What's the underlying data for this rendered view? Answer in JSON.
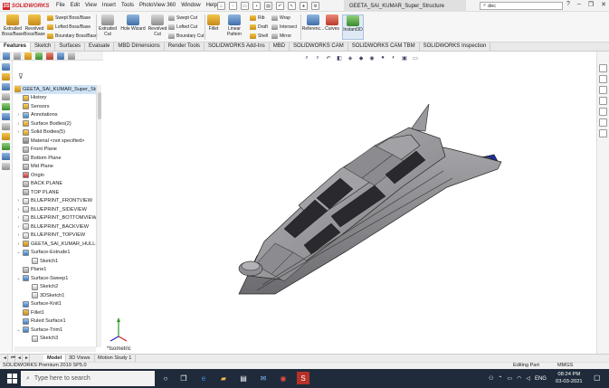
{
  "app": {
    "logo_text": "SOLIDWORKS",
    "document_title": "GEETA_SAI_KUMAR_Super_Structure",
    "search_value": "dec"
  },
  "menu": [
    "File",
    "Edit",
    "View",
    "Insert",
    "Tools",
    "PhotoView 360",
    "Window",
    "Help"
  ],
  "ribbon": {
    "extruded_boss": "Extruded Boss/Base",
    "revolved_boss": "Revolved Boss/Base",
    "swept_boss": "Swept Boss/Base",
    "lofted_boss": "Lofted Boss/Base",
    "boundary_boss": "Boundary Boss/Base",
    "extruded_cut": "Extruded Cut",
    "hole_wizard": "Hole Wizard",
    "revolved_cut": "Revolved Cut",
    "swept_cut": "Swept Cut",
    "lofted_cut": "Lofted Cut",
    "boundary_cut": "Boundary Cut",
    "fillet": "Fillet",
    "linear_pattern": "Linear Pattern",
    "rib": "Rib",
    "draft": "Draft",
    "shell": "Shell",
    "wrap": "Wrap",
    "intersect": "Intersect",
    "mirror": "Mirror",
    "reference": "Referenc...",
    "curves": "Curves",
    "instant3d": "Instant3D"
  },
  "command_tabs": [
    "Features",
    "Sketch",
    "Surfaces",
    "Evaluate",
    "MBD Dimensions",
    "Render Tools",
    "SOLIDWORKS Add-Ins",
    "MBD",
    "SOLIDWORKS CAM",
    "SOLIDWORKS CAM TBM",
    "SOLIDWORKS Inspection"
  ],
  "tree": {
    "root": "GEETA_SAI_KUMAR_Super_Structu",
    "items": [
      {
        "label": "History",
        "indent": 1,
        "exp": "",
        "icon": "folder"
      },
      {
        "label": "Sensors",
        "indent": 1,
        "exp": "",
        "icon": "folder"
      },
      {
        "label": "Annotations",
        "indent": 1,
        "exp": "›",
        "icon": "annot"
      },
      {
        "label": "Surface Bodies(2)",
        "indent": 1,
        "exp": "›",
        "icon": "folder"
      },
      {
        "label": "Solid Bodies(5)",
        "indent": 1,
        "exp": "›",
        "icon": "folder"
      },
      {
        "label": "Material <not specified>",
        "indent": 1,
        "exp": "",
        "icon": "material"
      },
      {
        "label": "Front Plane",
        "indent": 1,
        "exp": "",
        "icon": "plane"
      },
      {
        "label": "Bottom Plane",
        "indent": 1,
        "exp": "",
        "icon": "plane"
      },
      {
        "label": "Mid Plane",
        "indent": 1,
        "exp": "",
        "icon": "plane"
      },
      {
        "label": "Origin",
        "indent": 1,
        "exp": "",
        "icon": "origin"
      },
      {
        "label": "BACK PLANE",
        "indent": 1,
        "exp": "",
        "icon": "plane"
      },
      {
        "label": "TOP PLANE",
        "indent": 1,
        "exp": "",
        "icon": "plane"
      },
      {
        "label": "BLUEPRINT_FRONTVIEW",
        "indent": 1,
        "exp": "›",
        "icon": "sketch"
      },
      {
        "label": "BLUEPRINT_SIDEVIEW",
        "indent": 1,
        "exp": "›",
        "icon": "sketch"
      },
      {
        "label": "BLUEPRINT_BOTTOMVIEW",
        "indent": 1,
        "exp": "›",
        "icon": "sketch"
      },
      {
        "label": "BLUEPRINT_BACKVIEW",
        "indent": 1,
        "exp": "›",
        "icon": "sketch"
      },
      {
        "label": "BLUEPRINT_TOPVIEW",
        "indent": 1,
        "exp": "›",
        "icon": "sketch"
      },
      {
        "label": "GEETA_SAI_KUMAR_HULL->?",
        "indent": 1,
        "exp": "›",
        "icon": "part"
      },
      {
        "label": "Surface-Extrude1",
        "indent": 1,
        "exp": "⌄",
        "icon": "surface"
      },
      {
        "label": "Sketch1",
        "indent": 2,
        "exp": "",
        "icon": "sketch"
      },
      {
        "label": "Plane1",
        "indent": 1,
        "exp": "",
        "icon": "plane"
      },
      {
        "label": "Surface-Sweep1",
        "indent": 1,
        "exp": "⌄",
        "icon": "surface"
      },
      {
        "label": "Sketch2",
        "indent": 2,
        "exp": "",
        "icon": "sketch"
      },
      {
        "label": "3DSketch1",
        "indent": 2,
        "exp": "",
        "icon": "sketch"
      },
      {
        "label": "Surface-Knit1",
        "indent": 1,
        "exp": "",
        "icon": "surface"
      },
      {
        "label": "Fillet1",
        "indent": 1,
        "exp": "",
        "icon": "fillet"
      },
      {
        "label": "Ruled Surface1",
        "indent": 1,
        "exp": "",
        "icon": "surface"
      },
      {
        "label": "Surface-Trim1",
        "indent": 1,
        "exp": "⌄",
        "icon": "surface"
      },
      {
        "label": "Sketch3",
        "indent": 2,
        "exp": "",
        "icon": "sketch"
      }
    ]
  },
  "viewport": {
    "view_label": "*Isometric"
  },
  "bottom_tabs": [
    "Model",
    "3D Views",
    "Motion Study 1"
  ],
  "status": {
    "left": "SOLIDWORKS Premium 2019 SP5.0",
    "mode": "Editing Part",
    "units": "MMGS"
  },
  "taskbar": {
    "search_placeholder": "Type here to search",
    "language": "ENG",
    "time": "08:24 PM",
    "date": "03-03-2021"
  },
  "colors": {
    "accent": "#d2232a",
    "selection": "#cfe3f7",
    "model_body": "#8a8a8e",
    "model_glass": "#2a2a2e",
    "model_blue": "#1f2f9a",
    "taskbar": "#1f2b3a"
  }
}
